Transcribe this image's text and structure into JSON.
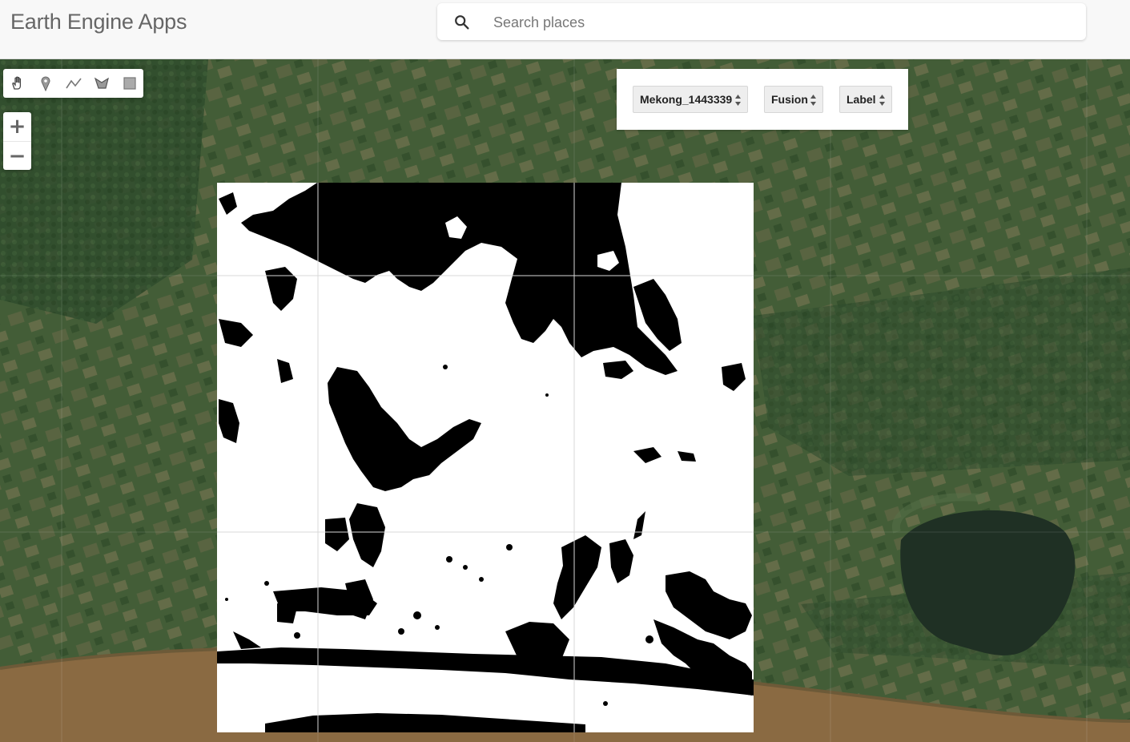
{
  "header": {
    "title": "Earth Engine Apps"
  },
  "search": {
    "placeholder": "Search places",
    "value": ""
  },
  "drawing_tools": [
    {
      "name": "pan",
      "icon": "hand-icon"
    },
    {
      "name": "point",
      "icon": "marker-icon"
    },
    {
      "name": "line",
      "icon": "line-icon"
    },
    {
      "name": "polygon",
      "icon": "polygon-icon"
    },
    {
      "name": "rectangle",
      "icon": "rectangle-icon"
    }
  ],
  "zoom": {
    "in_label": "+",
    "out_label": "−"
  },
  "controls": {
    "region_select": "Mekong_1443339",
    "source_select": "Fusion",
    "layer_select": "Label"
  },
  "colors": {
    "header_bg": "#f8f8f8",
    "mask_water": "#000000",
    "mask_land": "#ffffff",
    "river": "#8a6a42",
    "lake": "#1f3024"
  }
}
